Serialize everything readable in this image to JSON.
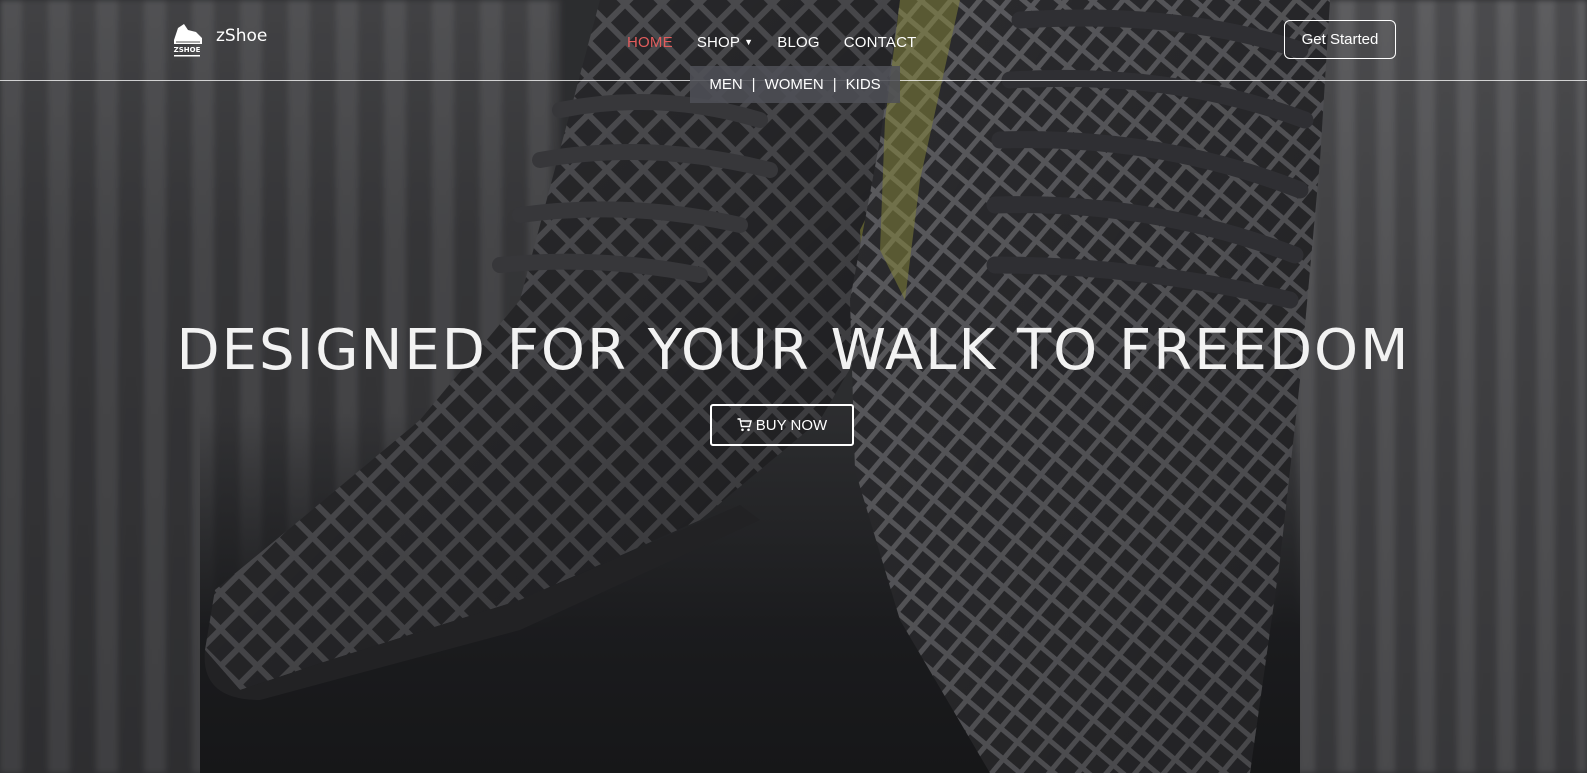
{
  "brand": {
    "name": "zShoe",
    "logo_icon": "shoe-logo-icon"
  },
  "nav": {
    "items": [
      {
        "label": "HOME",
        "active": true
      },
      {
        "label": "SHOP",
        "has_dropdown": true
      },
      {
        "label": "BLOG"
      },
      {
        "label": "CONTACT"
      }
    ],
    "dropdown": {
      "items": [
        "MEN",
        "WOMEN",
        "KIDS"
      ],
      "separator": "|"
    },
    "cta_label": "Get Started"
  },
  "hero": {
    "headline": "DESIGNED FOR YOUR WALK TO FREEDOM",
    "button_label": "BUY NOW",
    "button_icon": "cart-icon"
  },
  "colors": {
    "active_nav": "#e35d5d",
    "text": "#ffffff",
    "dropdown_bg": "#4e5056"
  }
}
